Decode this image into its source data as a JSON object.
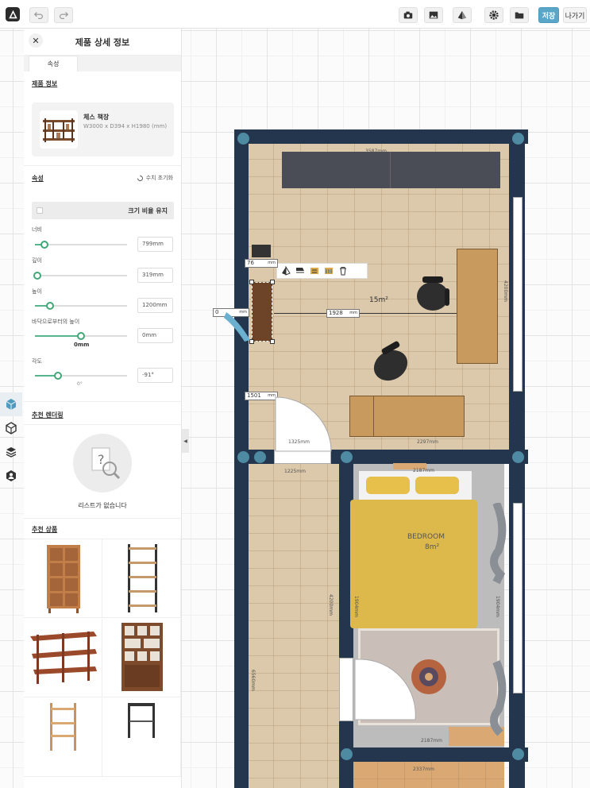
{
  "toolbar": {
    "save_label": "저장",
    "exit_label": "나가기"
  },
  "panel": {
    "title": "제품 상세 정보",
    "tab_label": "속성",
    "product_info_title": "제품 정보",
    "product_name": "체스 책장",
    "product_dims": "W3000 x D394 x H1980 (mm)",
    "attributes_title": "속성",
    "reset_label": "수치 초기화",
    "keep_ratio_label": "크기 비율 유지",
    "width_label": "너비",
    "width_value": "799mm",
    "width_level": 0.1,
    "depth_label": "깊이",
    "depth_value": "319mm",
    "depth_level": 0.03,
    "height_label": "높이",
    "height_value": "1200mm",
    "height_level": 0.16,
    "elevation_label": "바닥으로부터의 높이",
    "elevation_value": "0mm",
    "elevation_slider_label": "0mm",
    "elevation_level": 0.5,
    "angle_label": "각도",
    "angle_value": "-91°",
    "angle_slider_label": "0°",
    "angle_level": 0.25,
    "recommended_render_title": "추천 렌더링",
    "empty_list_text": "리스트가 없습니다",
    "recommended_products_title": "추천 상품"
  },
  "plan": {
    "dims": {
      "top_wall": "3587mm",
      "right_wall": "4200mm",
      "bottom_left": "1325mm",
      "bottom_right": "2297mm",
      "corridor_top": "1225mm",
      "bedroom_top": "2187mm",
      "bedroom_left": "1904mm",
      "bedroom_right": "1904mm",
      "corridor_left": "4200mm",
      "corridor_lower": "6560mm",
      "bedroom_bottom": "2187mm",
      "lower_room": "2337mm"
    },
    "living_area": "15m²",
    "bedroom_name": "BEDROOM",
    "bedroom_area": "8m²",
    "inputs": {
      "top_offset": "76",
      "top_offset_unit": "mm",
      "left_offset": "0",
      "left_offset_unit": "mm",
      "right_distance": "1928",
      "right_distance_unit": "mm",
      "bottom_offset": "1501",
      "bottom_offset_unit": "mm"
    }
  }
}
